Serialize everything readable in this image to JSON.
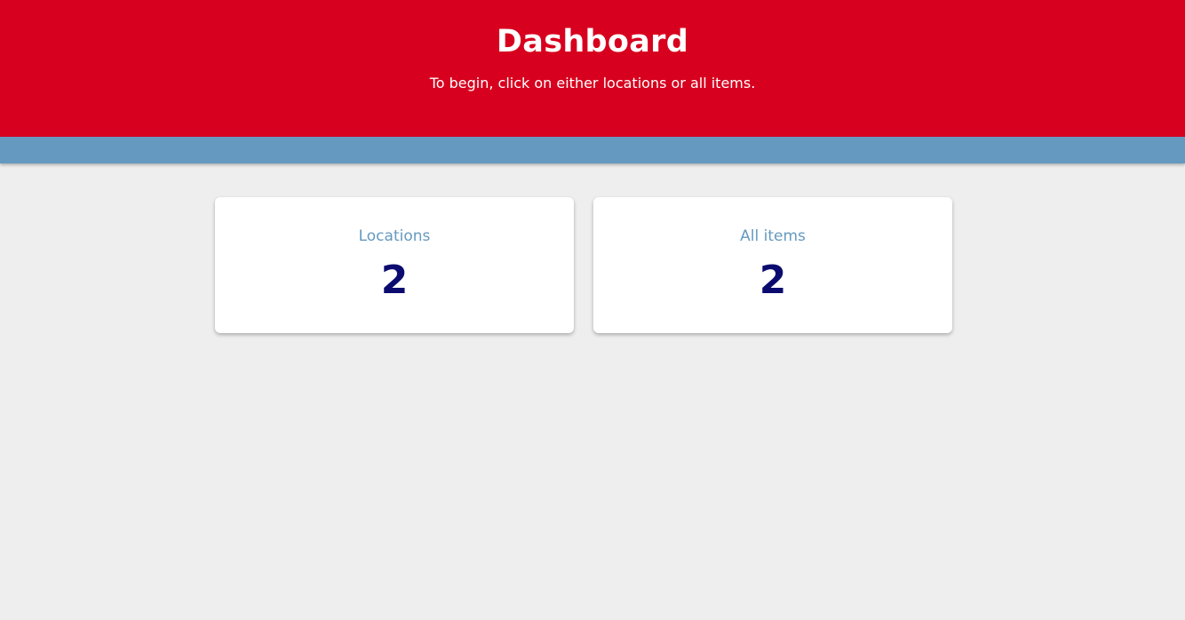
{
  "header": {
    "title": "Dashboard",
    "subtitle": "To begin, click on either locations or all items."
  },
  "cards": [
    {
      "label": "Locations",
      "value": "2"
    },
    {
      "label": "All items",
      "value": "2"
    }
  ],
  "colors": {
    "header_bg": "#d7001e",
    "nav_bar": "#6699c0",
    "page_bg": "#eeeeee",
    "card_label": "#6699c0",
    "card_value": "#0b0b6f"
  }
}
